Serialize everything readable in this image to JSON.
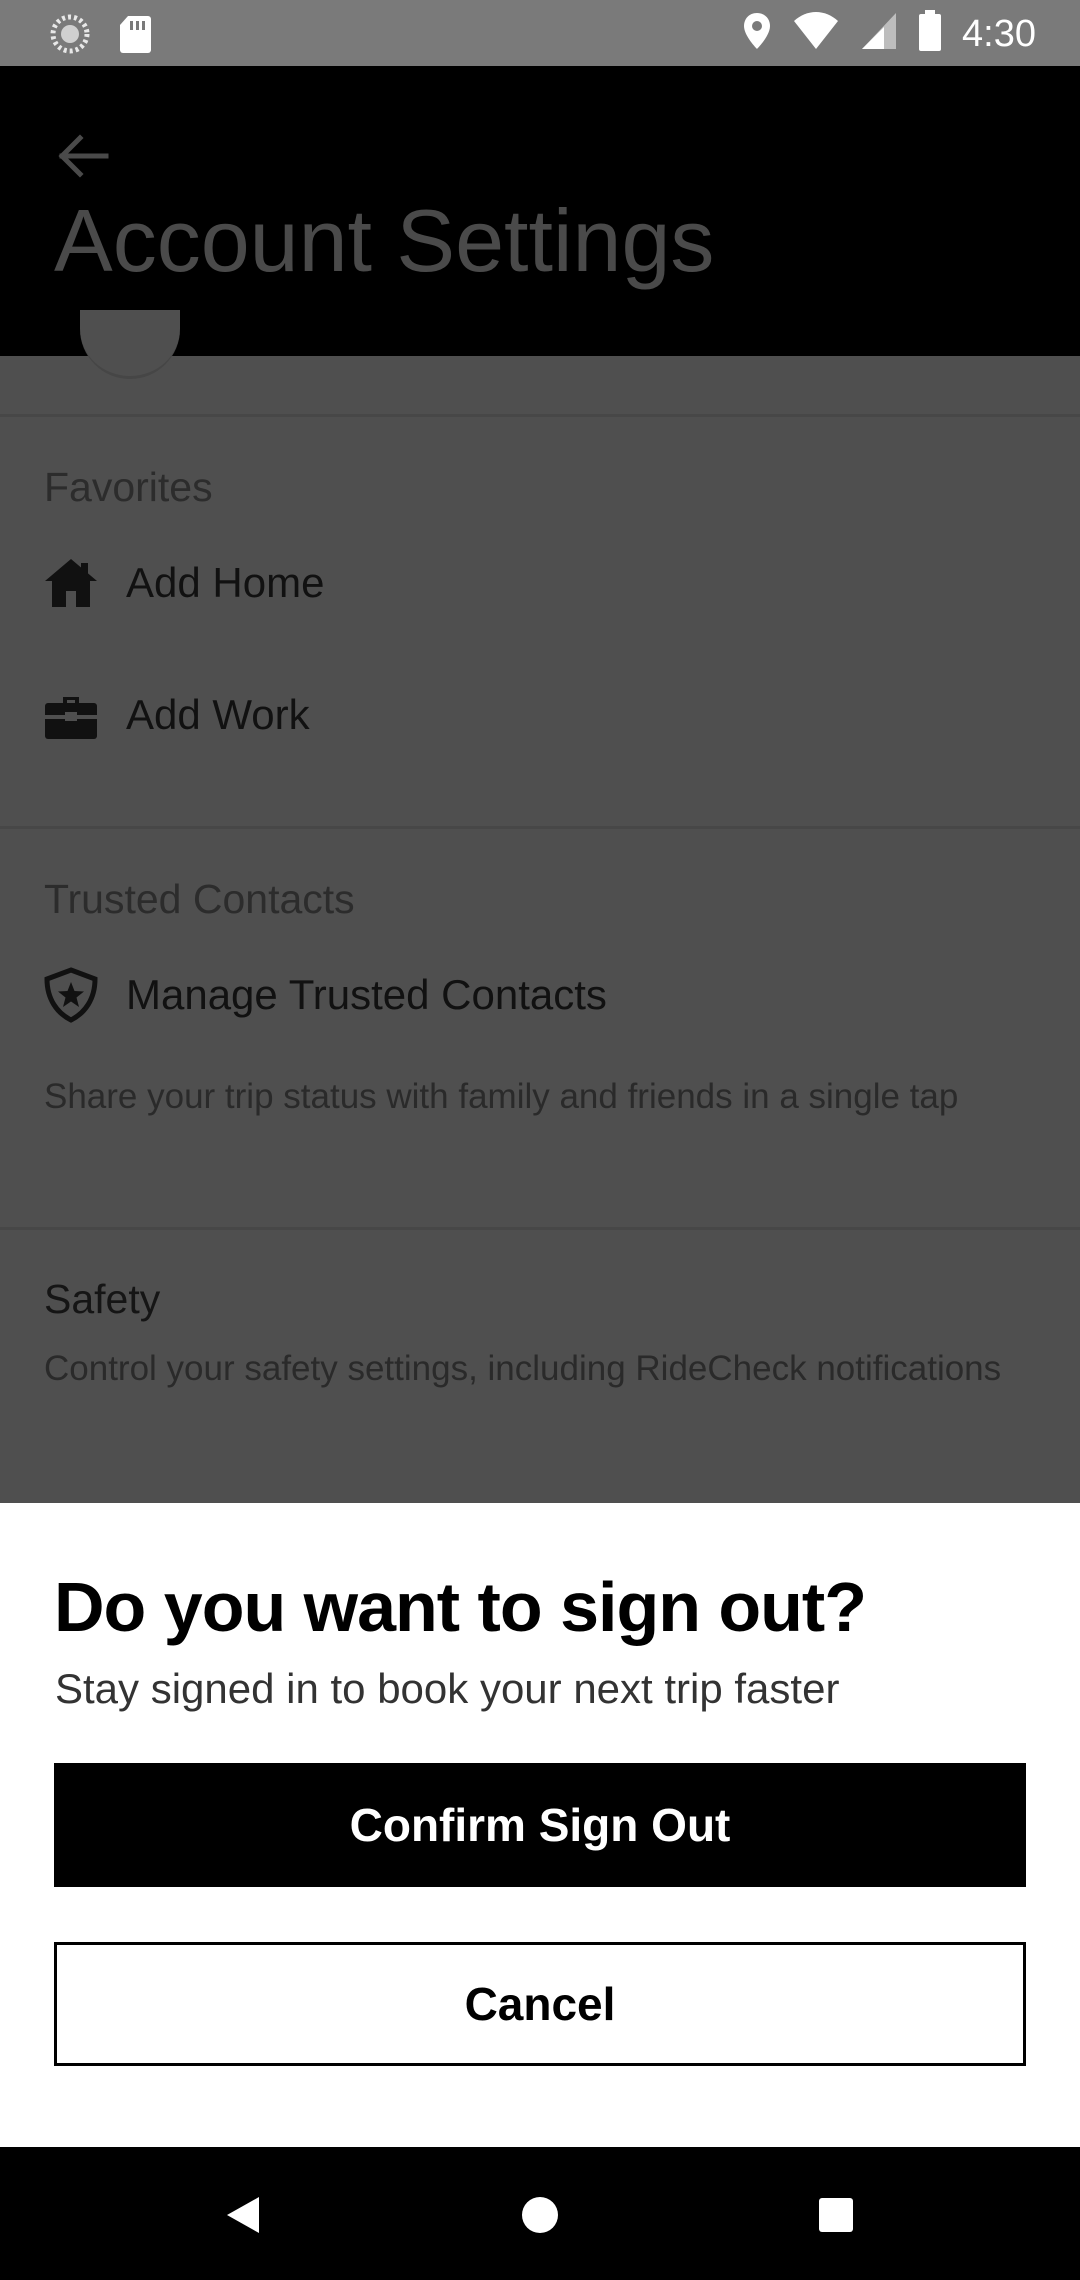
{
  "status_bar": {
    "time": "4:30",
    "icons": [
      "loading-icon",
      "sd-card-icon",
      "location-icon",
      "wifi-icon",
      "signal-icon",
      "battery-icon"
    ]
  },
  "header": {
    "title": "Account Settings",
    "back_icon": "back-arrow-icon"
  },
  "favorites": {
    "title": "Favorites",
    "items": [
      {
        "icon": "home-icon",
        "label": "Add Home"
      },
      {
        "icon": "briefcase-icon",
        "label": "Add Work"
      }
    ]
  },
  "trusted_contacts": {
    "title": "Trusted Contacts",
    "item": {
      "icon": "shield-star-icon",
      "label": "Manage Trusted Contacts"
    },
    "description": "Share your trip status with family and friends in a single tap"
  },
  "safety": {
    "title": "Safety",
    "description": "Control your safety settings, including RideCheck notifications"
  },
  "dialog": {
    "title": "Do you want to sign out?",
    "subtitle": "Stay signed in to book your next trip faster",
    "confirm_label": "Confirm Sign Out",
    "cancel_label": "Cancel"
  },
  "nav_bar": {
    "icons": [
      "back-triangle-icon",
      "home-circle-icon",
      "recents-square-icon"
    ]
  },
  "colors": {
    "overlay_content": "#4f4f4f",
    "header_bg": "#000000",
    "status_bar": "#7a7a7a",
    "primary_button": "#000000",
    "sheet_bg": "#ffffff"
  }
}
